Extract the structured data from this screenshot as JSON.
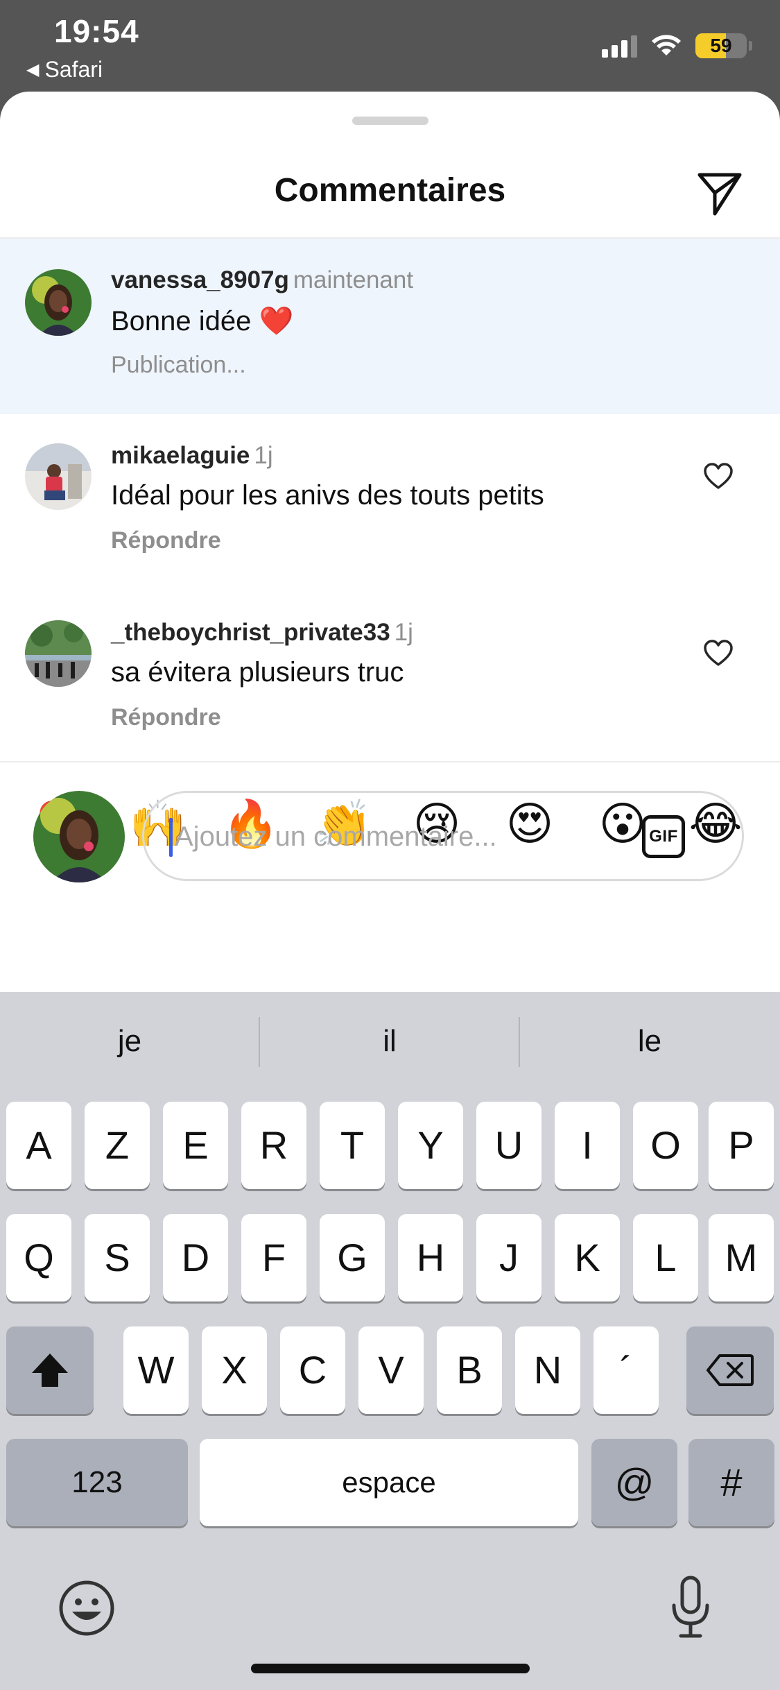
{
  "status_bar": {
    "time": "19:54",
    "back_app": "Safari",
    "battery": "59",
    "battery_level_percent": 59,
    "icons": [
      "cellular-signal-icon",
      "wifi-icon",
      "battery-icon"
    ]
  },
  "sheet": {
    "title": "Commentaires",
    "share_icon": "paper-plane-icon"
  },
  "comments": [
    {
      "user": "vanessa_8907g",
      "time": "maintenant",
      "text": "Bonne idée ❤️",
      "sub": "Publication...",
      "highlighted": true
    },
    {
      "user": "mikaelaguie",
      "time": "1j",
      "text": "Idéal pour les anivs des touts petits",
      "sub": "Répondre",
      "like_icon": "heart-outline-icon"
    },
    {
      "user": "_theboychrist_private33",
      "time": "1j",
      "text": "sa évitera plusieurs truc",
      "sub": "Répondre",
      "like_icon": "heart-outline-icon"
    }
  ],
  "quick_emojis": [
    "❤️",
    "🙌",
    "🔥",
    "👏",
    "😢",
    "😍",
    "😮",
    "😂"
  ],
  "composer": {
    "placeholder": "Ajoutez un commentaire...",
    "value": "",
    "gif_label": "GIF"
  },
  "keyboard": {
    "predictions": [
      "je",
      "il",
      "le"
    ],
    "row1": [
      "A",
      "Z",
      "E",
      "R",
      "T",
      "Y",
      "U",
      "I",
      "O",
      "P"
    ],
    "row2": [
      "Q",
      "S",
      "D",
      "F",
      "G",
      "H",
      "J",
      "K",
      "L",
      "M"
    ],
    "row3": [
      "W",
      "X",
      "C",
      "V",
      "B",
      "N",
      "´"
    ],
    "numbers_key": "123",
    "space_key": "espace",
    "at_key": "@",
    "hash_key": "#",
    "shift_icon": "shift-arrow-icon",
    "delete_icon": "backspace-icon",
    "emoji_icon": "emoji-keyboard-icon",
    "mic_icon": "microphone-icon"
  },
  "colors": {
    "highlight_bg": "#eff5fd",
    "caret": "#3b5ee8",
    "battery": "#f5cd2a",
    "keyboard_bg": "#d1d3d9"
  }
}
